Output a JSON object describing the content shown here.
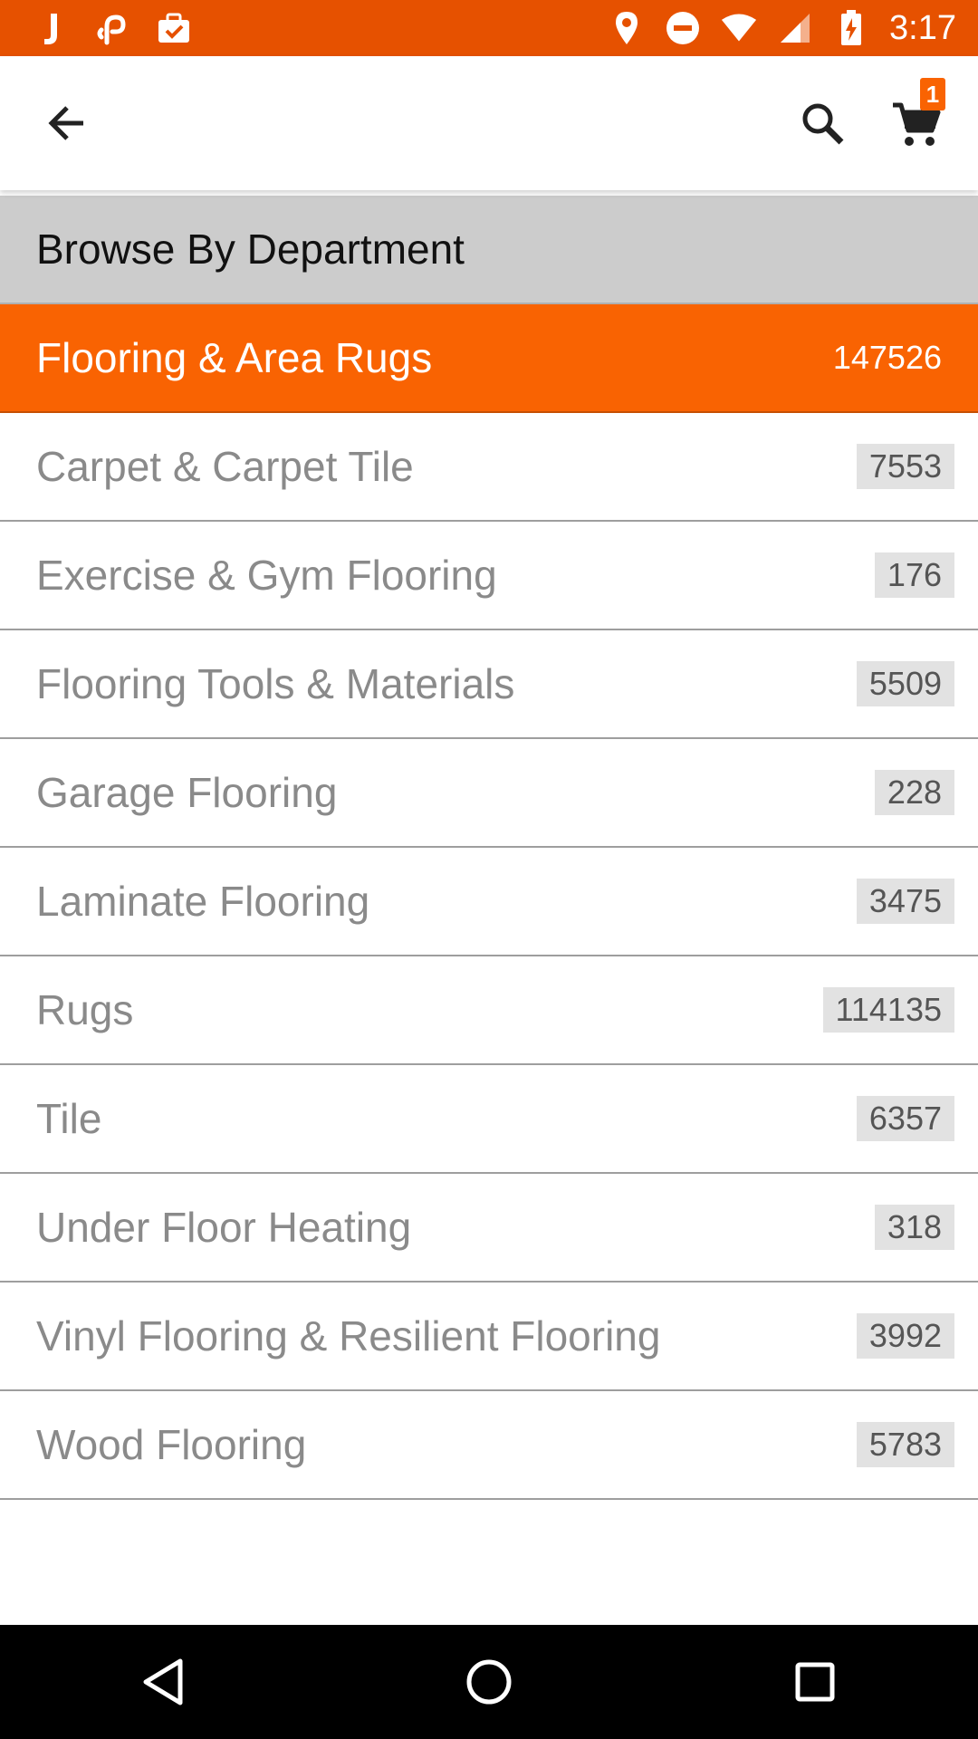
{
  "status_bar": {
    "time": "3:17",
    "background": "#e65100",
    "left_icons": [
      "j-app-icon",
      "link-app-icon",
      "briefcase-check-icon"
    ],
    "right_icons": [
      "location-pin-icon",
      "do-not-disturb-icon",
      "wifi-icon",
      "signal-icon",
      "battery-charging-icon"
    ]
  },
  "app_bar": {
    "back_icon": "arrow-back-icon",
    "search_icon": "search-icon",
    "cart_icon": "cart-icon",
    "cart_count": "1"
  },
  "section": {
    "title": "Browse By Department"
  },
  "departments": [
    {
      "label": "Flooring & Area Rugs",
      "count": "147526",
      "active": true
    },
    {
      "label": "Carpet & Carpet Tile",
      "count": "7553"
    },
    {
      "label": "Exercise & Gym Flooring",
      "count": "176"
    },
    {
      "label": "Flooring Tools & Materials",
      "count": "5509"
    },
    {
      "label": "Garage Flooring",
      "count": "228"
    },
    {
      "label": "Laminate Flooring",
      "count": "3475"
    },
    {
      "label": "Rugs",
      "count": "114135"
    },
    {
      "label": "Tile",
      "count": "6357"
    },
    {
      "label": "Under Floor Heating",
      "count": "318"
    },
    {
      "label": "Vinyl Flooring & Resilient Flooring",
      "count": "3992"
    },
    {
      "label": "Wood Flooring",
      "count": "5783"
    }
  ],
  "colors": {
    "accent": "#f96302",
    "status_bar": "#e65100",
    "section_header": "#cccccc"
  },
  "nav_bar": {
    "back_icon": "nav-back-icon",
    "home_icon": "nav-home-icon",
    "recents_icon": "nav-recents-icon"
  }
}
